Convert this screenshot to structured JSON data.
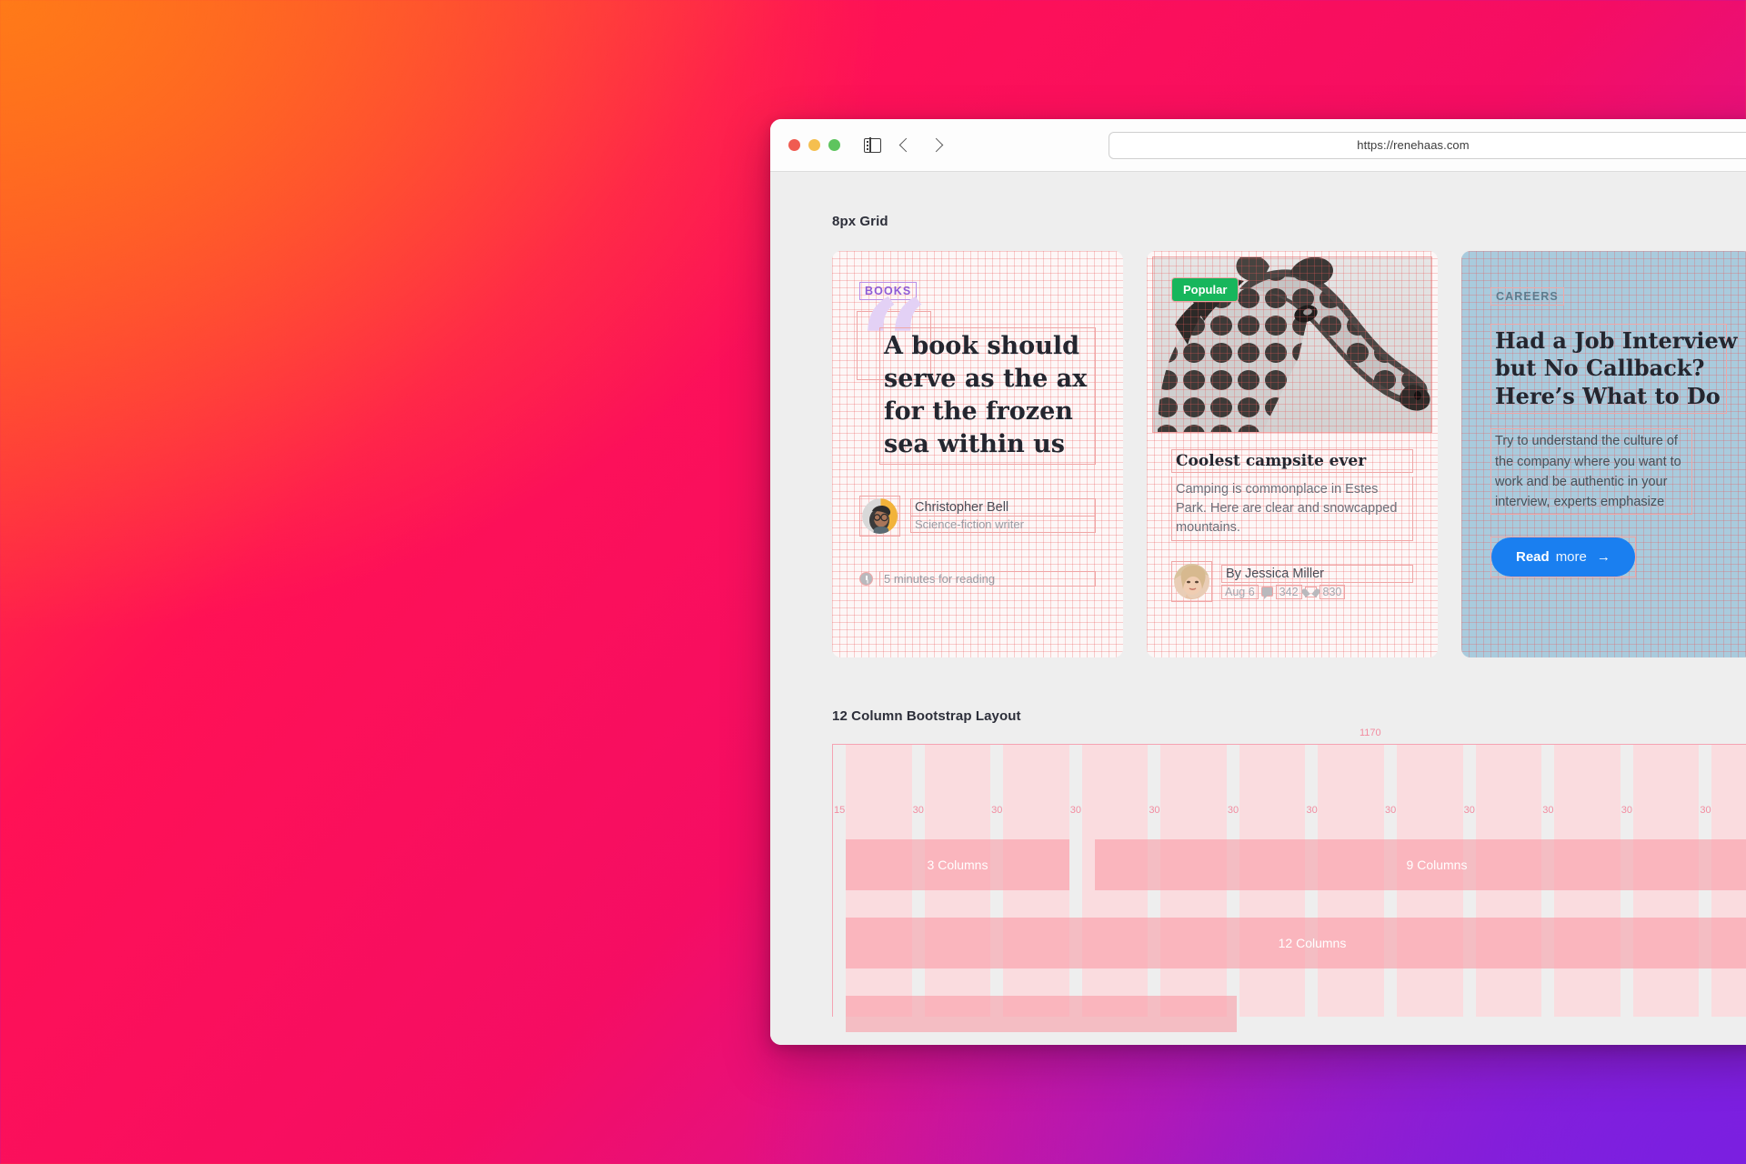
{
  "browser": {
    "url": "https://renehaas.com",
    "reload_icon": "reload-icon",
    "back_icon": "chevron-left-icon",
    "forward_icon": "chevron-right-icon",
    "sidebar_icon": "sidebar-toggle-icon",
    "traffic_lights": [
      "close",
      "minimize",
      "zoom"
    ]
  },
  "page": {
    "sections": [
      {
        "title": "8px Grid"
      },
      {
        "title": "12 Column Bootstrap Layout"
      }
    ]
  },
  "cards": {
    "books": {
      "tag": "BOOKS",
      "quote_mark": "“",
      "quote": "A book should serve as the ax for the frozen sea within us",
      "author_name": "Christopher Bell",
      "author_role": "Science-fiction writer",
      "reading_time": "5 minutes for reading",
      "clock_icon": "clock-icon"
    },
    "campsite": {
      "badge": "Popular",
      "badge_color": "#17b65c",
      "image_alt": "giraffe-photo",
      "title": "Coolest campsite ever",
      "description": "Camping is commonplace in Estes Park. Here are clear and snowcapped mountains.",
      "author_name": "By Jessica Miller",
      "date": "Aug 6",
      "comments": "342",
      "likes": "830",
      "comment_icon": "comment-icon",
      "heart_icon": "heart-icon"
    },
    "careers": {
      "tag": "CAREERS",
      "title_lines": [
        "Had a Job Interview",
        "but No Callback?",
        "Here’s What to Do"
      ],
      "description": "Try to understand the culture of the company where you want to work and be authentic in your interview, experts emphasize",
      "button_strong": "Read",
      "button_light": "more",
      "button_arrow": "→",
      "button_color": "#1a7ff0",
      "card_color": "#a9cbdd"
    }
  },
  "bootstrap": {
    "container_width_label": "1170",
    "gutter_labels": [
      "15",
      "30",
      "30",
      "30",
      "30",
      "30",
      "30",
      "30",
      "30",
      "30",
      "30",
      "30"
    ],
    "bands": [
      {
        "label": "3 Columns"
      },
      {
        "label": "9 Columns"
      },
      {
        "label": "12 Columns"
      },
      {
        "label": ""
      }
    ]
  }
}
